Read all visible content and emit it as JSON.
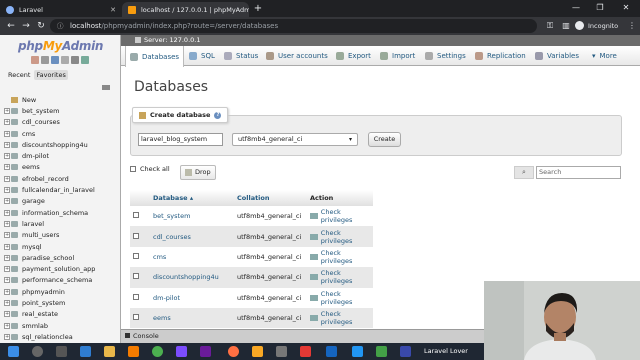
{
  "browser": {
    "tabs": [
      {
        "title": "Laravel"
      },
      {
        "title": "localhost / 127.0.0.1 | phpMyAdmi"
      }
    ],
    "address": {
      "host": "localhost",
      "path": "/phpmyadmin/index.php?route=/server/databases"
    },
    "profile_label": "Incognito"
  },
  "sidebar": {
    "logo_php": "php",
    "logo_my": "My",
    "logo_admin": "Admin",
    "recent_label": "Recent",
    "favorites_label": "Favorites",
    "new_label": "New",
    "databases": [
      "bet_system",
      "cdl_courses",
      "cms",
      "discountshopping4u",
      "dm-pilot",
      "eems",
      "efrobel_record",
      "fullcalendar_in_laravel",
      "garage",
      "information_schema",
      "laravel",
      "multi_users",
      "mysql",
      "paradise_school",
      "payment_solution_app",
      "performance_schema",
      "phpmyadmin",
      "point_system",
      "real_estate",
      "smmlab",
      "sql_relationclea"
    ]
  },
  "main": {
    "server_label": "Server: 127.0.0.1",
    "tabs": [
      "Databases",
      "SQL",
      "Status",
      "User accounts",
      "Export",
      "Import",
      "Settings",
      "Replication",
      "Variables",
      "More"
    ],
    "page_title": "Databases",
    "create": {
      "legend": "Create database",
      "name_value": "laravel_blog_system",
      "collation_value": "utf8mb4_general_ci",
      "button": "Create"
    },
    "toolbar": {
      "check_all": "Check all",
      "drop": "Drop",
      "search_placeholder": "Search"
    },
    "table": {
      "headers": {
        "database": "Database",
        "collation": "Collation",
        "action": "Action"
      },
      "rows": [
        {
          "name": "bet_system",
          "collation": "utf8mb4_general_ci",
          "action": "Check privileges"
        },
        {
          "name": "cdl_courses",
          "collation": "utf8mb4_general_ci",
          "action": "Check privileges"
        },
        {
          "name": "cms",
          "collation": "utf8mb4_general_ci",
          "action": "Check privileges"
        },
        {
          "name": "discountshopping4u",
          "collation": "utf8mb4_general_ci",
          "action": "Check privileges"
        },
        {
          "name": "dm-pilot",
          "collation": "utf8mb4_general_ci",
          "action": "Check privileges"
        },
        {
          "name": "eems",
          "collation": "utf8mb4_general_ci",
          "action": "Check privileges"
        }
      ]
    },
    "console_label": "Console"
  },
  "taskbar": {
    "active_window": "Laravel Lover"
  },
  "colors": {
    "pma_link": "#235a81",
    "browser_dark": "#202124",
    "taskbar": "#1f2733"
  }
}
